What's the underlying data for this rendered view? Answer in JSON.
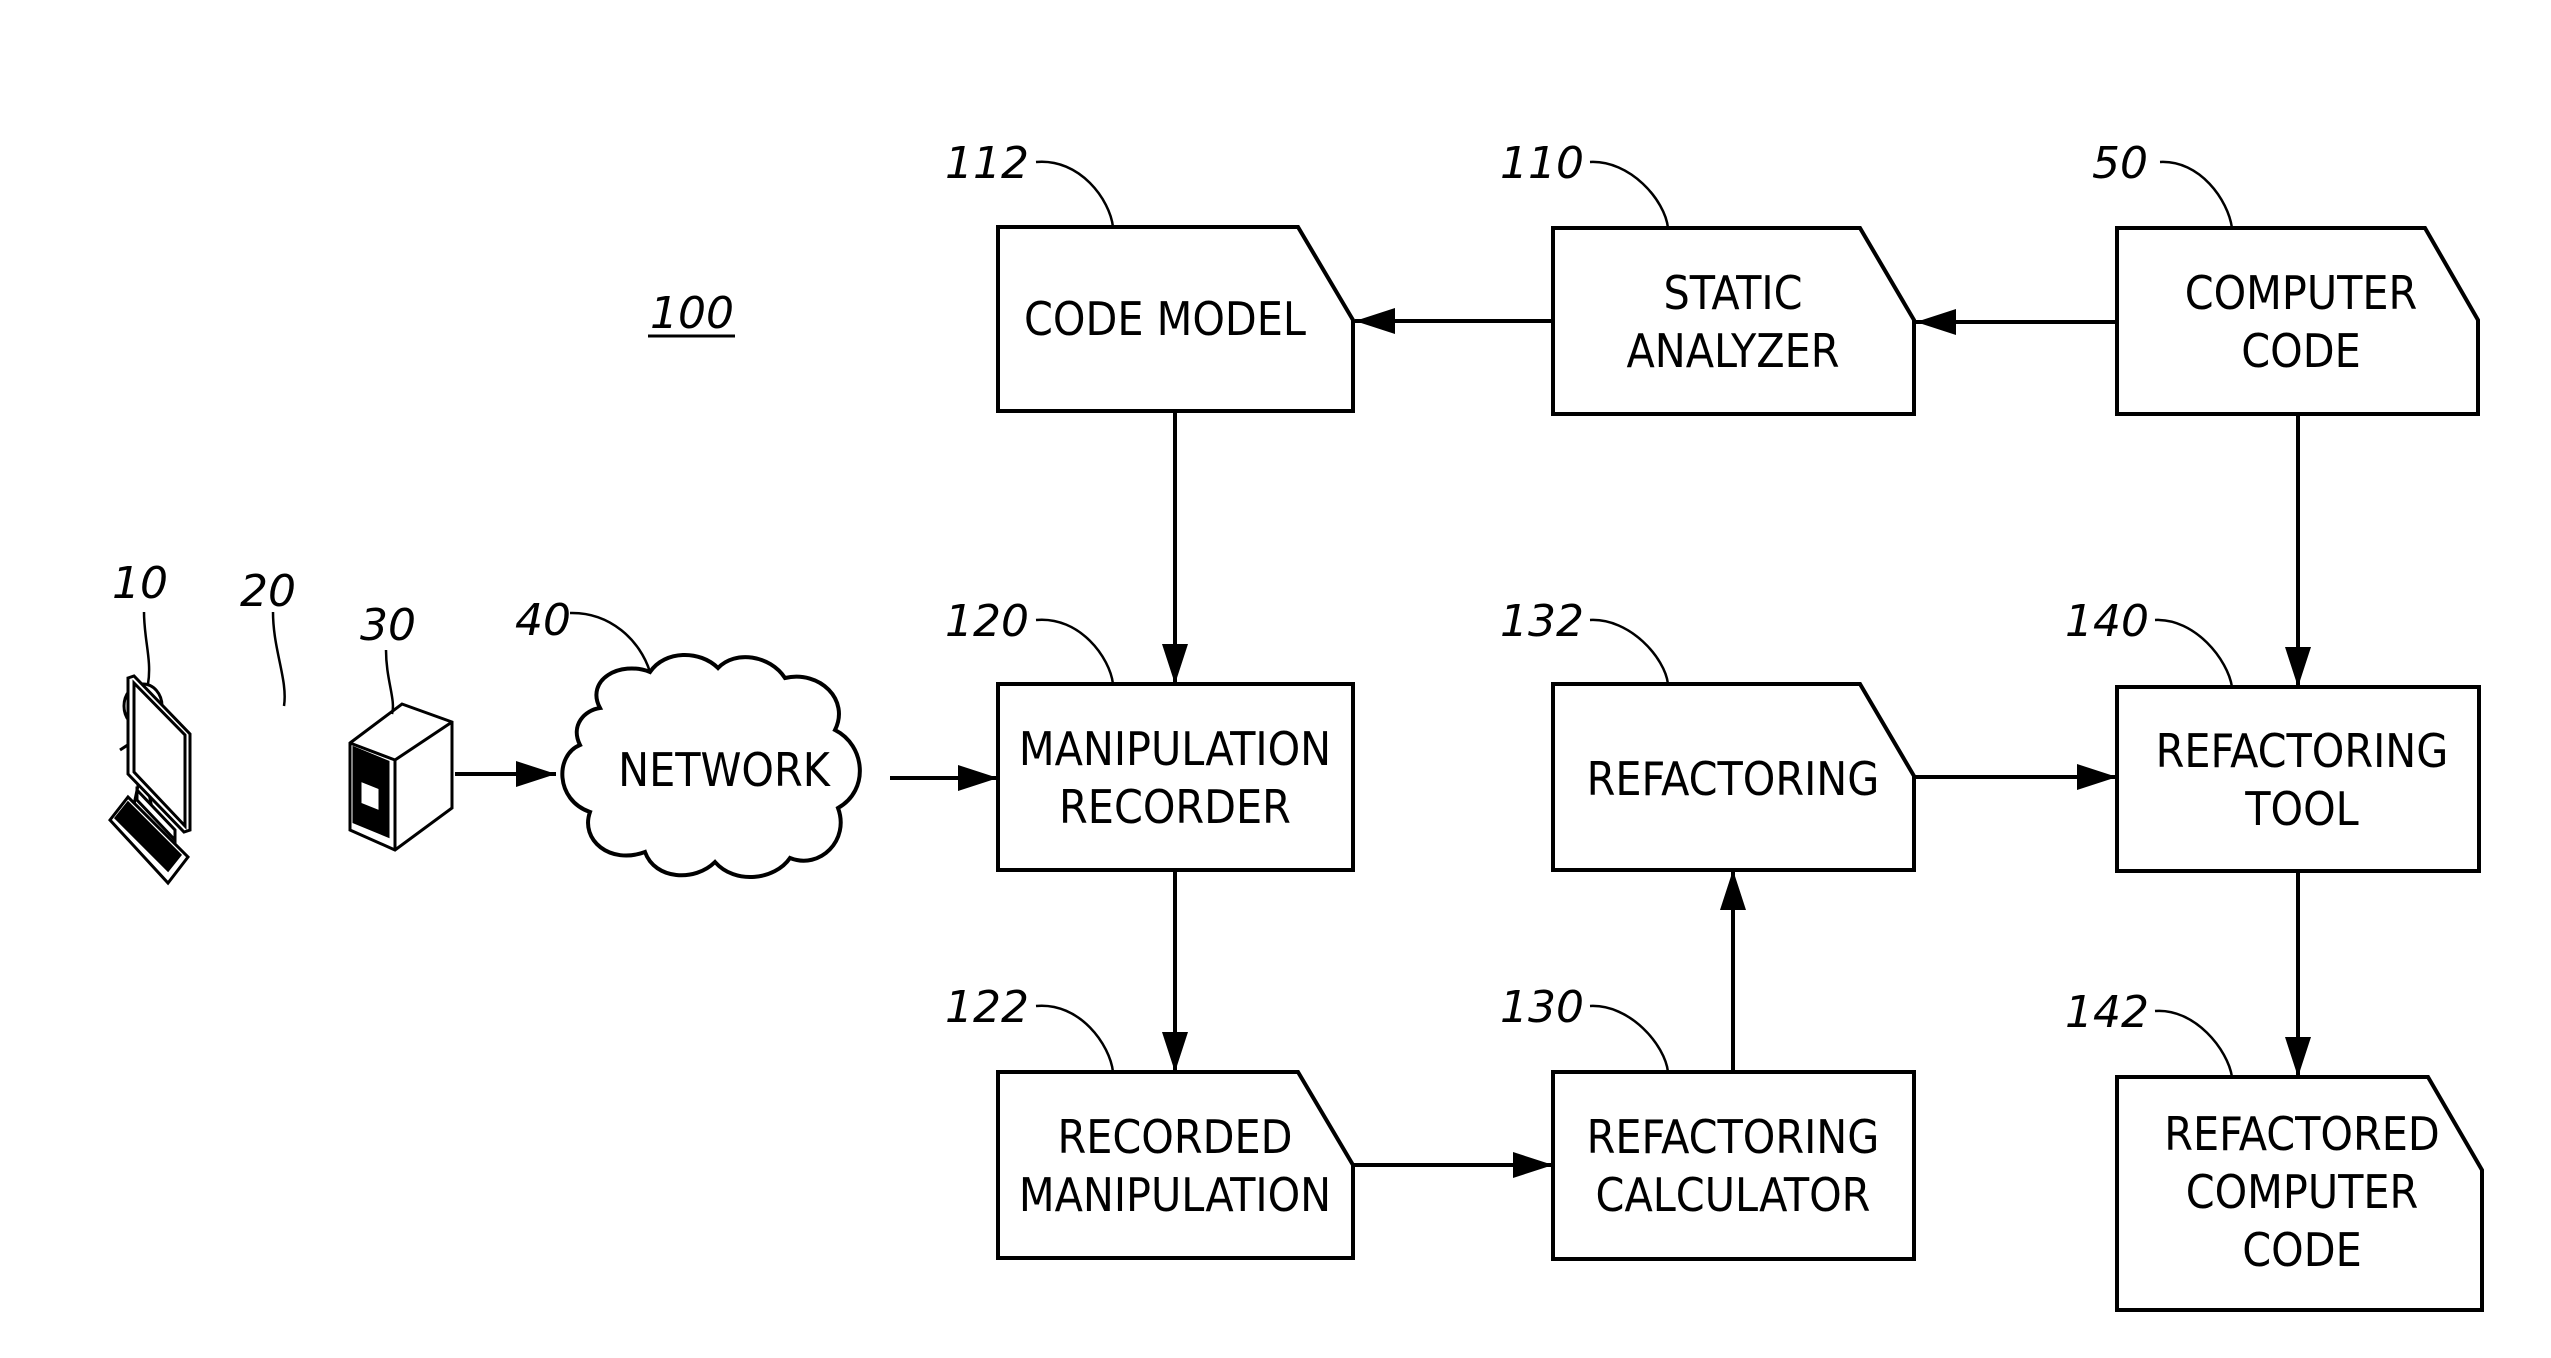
{
  "figure_label": "100",
  "blocks": {
    "code_model": {
      "ref": "112",
      "lines": [
        "CODE  MODEL"
      ]
    },
    "static_analyzer": {
      "ref": "110",
      "lines": [
        "STATIC",
        "ANALYZER"
      ]
    },
    "computer_code": {
      "ref": "50",
      "lines": [
        "COMPUTER",
        "CODE"
      ]
    },
    "manipulation_recorder": {
      "ref": "120",
      "lines": [
        "MANIPULATION",
        "RECORDER"
      ]
    },
    "refactoring": {
      "ref": "132",
      "lines": [
        "REFACTORING"
      ]
    },
    "refactoring_tool": {
      "ref": "140",
      "lines": [
        "REFACTORING",
        "TOOL"
      ]
    },
    "recorded_manipulation": {
      "ref": "122",
      "lines": [
        "RECORDED",
        "MANIPULATION"
      ]
    },
    "refactoring_calculator": {
      "ref": "130",
      "lines": [
        "REFACTORING",
        "CALCULATOR"
      ]
    },
    "refactored_computer_code": {
      "ref": "142",
      "lines": [
        "REFACTORED",
        "COMPUTER",
        "CODE"
      ]
    }
  },
  "devices": {
    "user": {
      "ref": "10"
    },
    "terminal": {
      "ref": "20"
    },
    "computer": {
      "ref": "30"
    },
    "network": {
      "ref": "40",
      "label": "NETWORK"
    }
  }
}
